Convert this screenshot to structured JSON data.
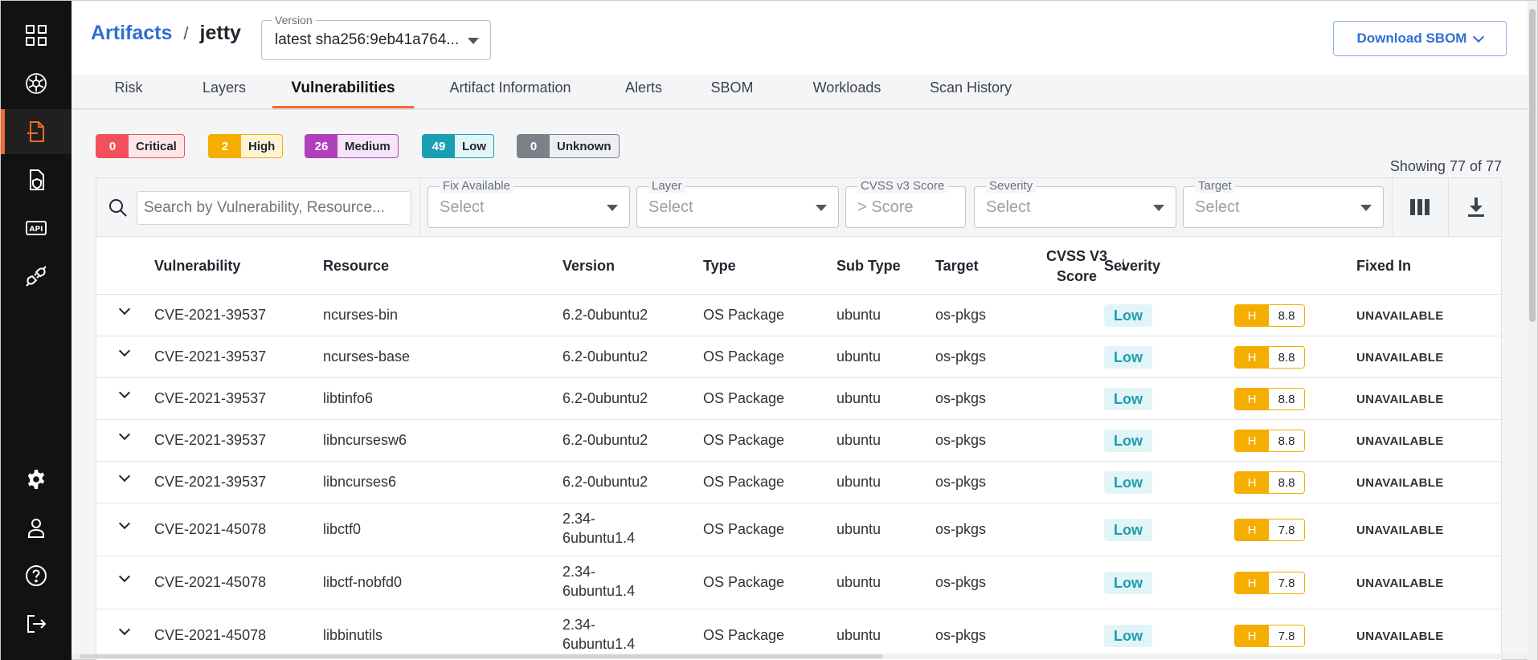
{
  "sidebar": {
    "items": [
      {
        "icon": "grid-icon",
        "active": false
      },
      {
        "icon": "kubernetes-icon",
        "active": false
      },
      {
        "icon": "artifact-icon",
        "active": true
      },
      {
        "icon": "shield-document-icon",
        "active": false
      },
      {
        "icon": "api-icon",
        "active": false
      },
      {
        "icon": "plug-icon",
        "active": false
      }
    ],
    "bottom_items": [
      {
        "icon": "gear-icon"
      },
      {
        "icon": "user-icon"
      },
      {
        "icon": "help-icon"
      },
      {
        "icon": "logout-icon"
      }
    ],
    "api_label": "API"
  },
  "header": {
    "breadcrumb_root": "Artifacts",
    "breadcrumb_sep": "/",
    "breadcrumb_current": "jetty",
    "version_label": "Version",
    "version_value": "latest  sha256:9eb41a764...",
    "download_label": "Download SBOM"
  },
  "tabs": [
    "Risk",
    "Layers",
    "Vulnerabilities",
    "Artifact Information",
    "Alerts",
    "SBOM",
    "Workloads",
    "Scan History"
  ],
  "active_tab": "Vulnerabilities",
  "severity_summary": [
    {
      "count": "0",
      "label": "Critical",
      "color": "#f2505a",
      "bg": "#fde6e7"
    },
    {
      "count": "2",
      "label": "High",
      "color": "#f5ad00",
      "bg": "#fff3d6"
    },
    {
      "count": "26",
      "label": "Medium",
      "color": "#b13fb9",
      "bg": "#f6e4f7"
    },
    {
      "count": "49",
      "label": "Low",
      "color": "#1a9fb0",
      "bg": "#e3f4f7"
    },
    {
      "count": "0",
      "label": "Unknown",
      "color": "#7b8089",
      "bg": "#eceef1"
    }
  ],
  "showing": "Showing 77 of 77",
  "filters": {
    "search_placeholder": "Search by Vulnerability, Resource...",
    "fix_available": {
      "label": "Fix Available",
      "value": "Select"
    },
    "layer": {
      "label": "Layer",
      "value": "Select"
    },
    "cvss": {
      "label": "CVSS v3 Score",
      "value": "> Score"
    },
    "severity": {
      "label": "Severity",
      "value": "Select"
    },
    "target": {
      "label": "Target",
      "value": "Select"
    }
  },
  "table": {
    "headers": {
      "vulnerability": "Vulnerability",
      "resource": "Resource",
      "version": "Version",
      "type": "Type",
      "subtype": "Sub Type",
      "target": "Target",
      "severity": "Severity",
      "cvss_line1": "CVSS V3",
      "cvss_line2": "Score",
      "sort_arrow": "↓",
      "fixed_in": "Fixed In"
    },
    "rows": [
      {
        "vulnerability": "CVE-2021-39537",
        "resource": "ncurses-bin",
        "version": "6.2-0ubuntu2",
        "type": "OS Package",
        "subtype": "ubuntu",
        "target": "os-pkgs",
        "severity": "Low",
        "cvss_sev": "H",
        "cvss_score": "8.8",
        "fixed_in": "UNAVAILABLE"
      },
      {
        "vulnerability": "CVE-2021-39537",
        "resource": "ncurses-base",
        "version": "6.2-0ubuntu2",
        "type": "OS Package",
        "subtype": "ubuntu",
        "target": "os-pkgs",
        "severity": "Low",
        "cvss_sev": "H",
        "cvss_score": "8.8",
        "fixed_in": "UNAVAILABLE"
      },
      {
        "vulnerability": "CVE-2021-39537",
        "resource": "libtinfo6",
        "version": "6.2-0ubuntu2",
        "type": "OS Package",
        "subtype": "ubuntu",
        "target": "os-pkgs",
        "severity": "Low",
        "cvss_sev": "H",
        "cvss_score": "8.8",
        "fixed_in": "UNAVAILABLE"
      },
      {
        "vulnerability": "CVE-2021-39537",
        "resource": "libncursesw6",
        "version": "6.2-0ubuntu2",
        "type": "OS Package",
        "subtype": "ubuntu",
        "target": "os-pkgs",
        "severity": "Low",
        "cvss_sev": "H",
        "cvss_score": "8.8",
        "fixed_in": "UNAVAILABLE"
      },
      {
        "vulnerability": "CVE-2021-39537",
        "resource": "libncurses6",
        "version": "6.2-0ubuntu2",
        "type": "OS Package",
        "subtype": "ubuntu",
        "target": "os-pkgs",
        "severity": "Low",
        "cvss_sev": "H",
        "cvss_score": "8.8",
        "fixed_in": "UNAVAILABLE"
      },
      {
        "vulnerability": "CVE-2021-45078",
        "resource": "libctf0",
        "version": "2.34-6ubuntu1.4",
        "type": "OS Package",
        "subtype": "ubuntu",
        "target": "os-pkgs",
        "severity": "Low",
        "cvss_sev": "H",
        "cvss_score": "7.8",
        "fixed_in": "UNAVAILABLE"
      },
      {
        "vulnerability": "CVE-2021-45078",
        "resource": "libctf-nobfd0",
        "version": "2.34-6ubuntu1.4",
        "type": "OS Package",
        "subtype": "ubuntu",
        "target": "os-pkgs",
        "severity": "Low",
        "cvss_sev": "H",
        "cvss_score": "7.8",
        "fixed_in": "UNAVAILABLE"
      },
      {
        "vulnerability": "CVE-2021-45078",
        "resource": "libbinutils",
        "version": "2.34-6ubuntu1.4",
        "type": "OS Package",
        "subtype": "ubuntu",
        "target": "os-pkgs",
        "severity": "Low",
        "cvss_sev": "H",
        "cvss_score": "7.8",
        "fixed_in": "UNAVAILABLE"
      }
    ]
  }
}
